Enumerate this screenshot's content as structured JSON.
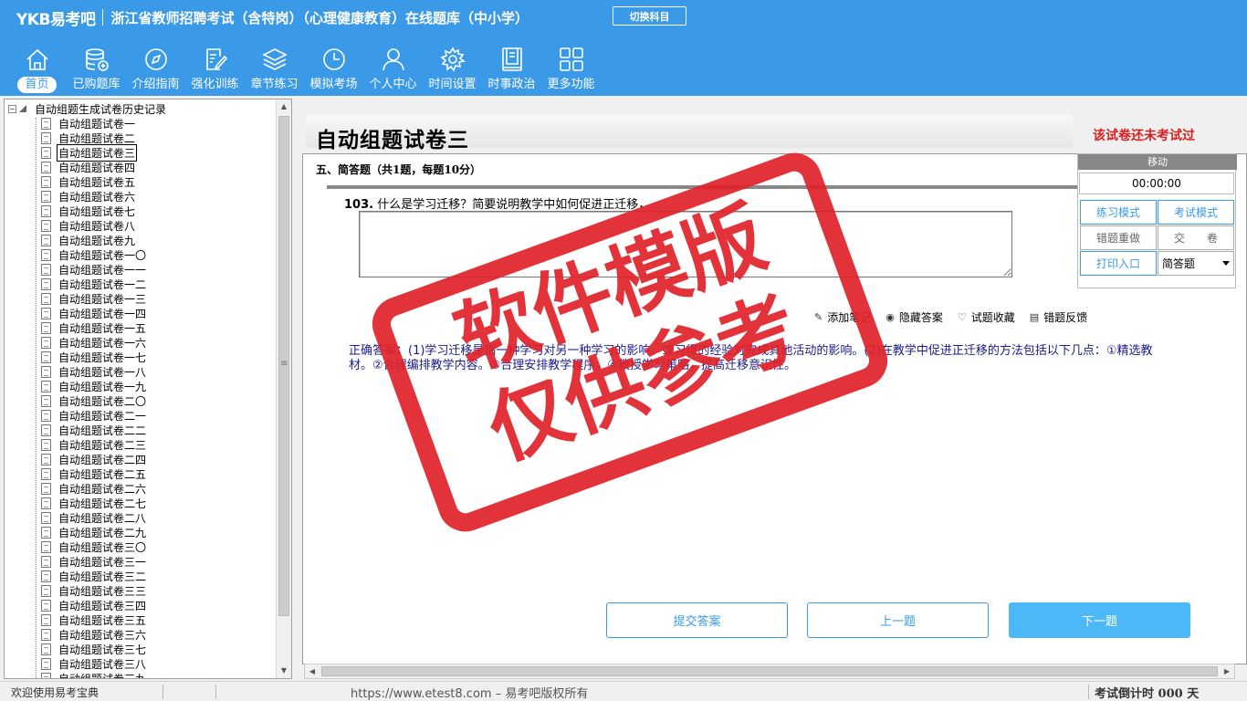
{
  "header": {
    "logo": "YKB易考吧",
    "title": "浙江省教师招聘考试（含特岗）（心理健康教育）在线题库（中小学）",
    "switch_label": "切换科目"
  },
  "nav": [
    {
      "label": "首页",
      "icon": "home-icon"
    },
    {
      "label": "已购题库",
      "icon": "database-icon"
    },
    {
      "label": "介绍指南",
      "icon": "compass-icon"
    },
    {
      "label": "强化训练",
      "icon": "edit-icon"
    },
    {
      "label": "章节练习",
      "icon": "layers-icon"
    },
    {
      "label": "模拟考场",
      "icon": "clock-icon"
    },
    {
      "label": "个人中心",
      "icon": "user-icon"
    },
    {
      "label": "时间设置",
      "icon": "gear-icon"
    },
    {
      "label": "时事政治",
      "icon": "book-icon"
    },
    {
      "label": "更多功能",
      "icon": "grid-icon"
    }
  ],
  "tree": {
    "root": "自动组题生成试卷历史记录",
    "items": [
      "自动组题试卷一",
      "自动组题试卷二",
      "自动组题试卷三",
      "自动组题试卷四",
      "自动组题试卷五",
      "自动组题试卷六",
      "自动组题试卷七",
      "自动组题试卷八",
      "自动组题试卷九",
      "自动组题试卷一〇",
      "自动组题试卷一一",
      "自动组题试卷一二",
      "自动组题试卷一三",
      "自动组题试卷一四",
      "自动组题试卷一五",
      "自动组题试卷一六",
      "自动组题试卷一七",
      "自动组题试卷一八",
      "自动组题试卷一九",
      "自动组题试卷二〇",
      "自动组题试卷二一",
      "自动组题试卷二二",
      "自动组题试卷二三",
      "自动组题试卷二四",
      "自动组题试卷二五",
      "自动组题试卷二六",
      "自动组题试卷二七",
      "自动组题试卷二八",
      "自动组题试卷二九",
      "自动组题试卷三〇",
      "自动组题试卷三一",
      "自动组题试卷三二",
      "自动组题试卷三三",
      "自动组题试卷三四",
      "自动组题试卷三五",
      "自动组题试卷三六",
      "自动组题试卷三七",
      "自动组题试卷三八",
      "自动组题试卷三九"
    ],
    "selected_index": 2
  },
  "paper": {
    "title": "自动组题试卷三",
    "status": "该试卷还未考试过",
    "section": "五、简答题（共1题，每题10分）"
  },
  "question": {
    "number": "103.",
    "text": "什么是学习迁移？简要说明教学中如何促进正迁移，",
    "answer_value": "",
    "tools": [
      {
        "label": "添加笔记",
        "icon": "pencil-icon"
      },
      {
        "label": "隐藏答案",
        "icon": "eye-icon"
      },
      {
        "label": "试题收藏",
        "icon": "heart-icon"
      },
      {
        "label": "错题反馈",
        "icon": "feedback-icon"
      }
    ],
    "correct_answer": "正确答案：(1)学习迁移是指一种学习对另一种学习的影响，或习得的经验对完成其他活动的影响。(2)在教学中促进正迁移的方法包括以下几点：①精选教材。②合理编排教学内容。③合理安排教学程序。④教授学习策略，提高迁移意识性。"
  },
  "panel": {
    "move_label": "移动",
    "timer": "00:00:00",
    "practice_mode": "练习模式",
    "exam_mode": "考试模式",
    "redo_wrong": "错题重做",
    "submit_paper": "交　　卷",
    "print_entry": "打印入口",
    "type_select": "简答题"
  },
  "buttons": {
    "submit": "提交答案",
    "prev": "上一题",
    "next": "下一题"
  },
  "stamp": {
    "line1": "软件模版",
    "line2": "仅供参考"
  },
  "status": {
    "welcome": "欢迎使用易考宝典",
    "url": "https://www.etest8.com – 易考吧版权所有",
    "countdown": "考试倒计时 000 天"
  },
  "colors": {
    "header_bg": "#3a9ae8",
    "stamp_red": "#e0222a",
    "status_red": "#d81e1e",
    "primary_button": "#4db8f8"
  }
}
